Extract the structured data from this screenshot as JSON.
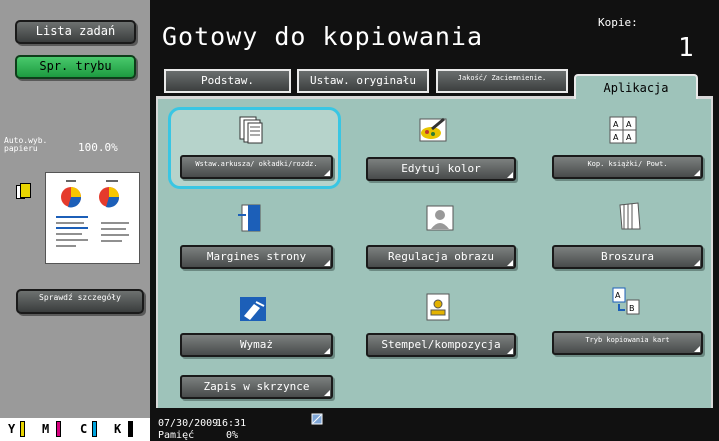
{
  "left": {
    "task_list_label": "Lista zadań",
    "check_mode_label": "Spr. trybu",
    "paper_label": "Auto.wyb. papieru",
    "zoom": "100.0%",
    "check_details_label": "Sprawdź szczegóły",
    "toner": [
      "Y",
      "M",
      "C",
      "K"
    ]
  },
  "header": {
    "title": "Gotowy do kopiowania",
    "copies_label": "Kopie:",
    "copies_value": "1"
  },
  "tabs": {
    "basic": "Podstaw.",
    "original": "Ustaw. oryginału",
    "quality": "Jakość/ Zaciemnienie.",
    "application": "Aplikacja"
  },
  "functions": {
    "sheet_cover": "Wstaw.arkusza/ okładki/rozdz.",
    "edit_color": "Edytuj kolor",
    "book_copy": "Kop. książki/ Powt.",
    "page_margin": "Margines strony",
    "image_adjust": "Regulacja obrazu",
    "booklet": "Broszura",
    "erase": "Wymaż",
    "stamp": "Stempel/kompozycja",
    "card_mode": "Tryb kopiowania kart",
    "box_save": "Zapis w skrzynce"
  },
  "status": {
    "date": "07/30/2009",
    "time": "16:31",
    "memory_label": "Pamięć",
    "memory_value": "0%"
  },
  "colors": {
    "panel": "#9ec3ba",
    "highlight": "#39c6e3",
    "green_button": "#1d9b40",
    "toner_y": "#e8d400",
    "toner_m": "#d6007f",
    "toner_c": "#00a4de",
    "toner_k": "#000000"
  },
  "icons": [
    "sheet-stack-icon",
    "brush-palette-icon",
    "book-pages-icon",
    "margin-page-icon",
    "image-adjust-icon",
    "booklet-icon",
    "erase-icon",
    "stamp-icon",
    "card-copy-icon",
    "network-icon",
    "tray-icon"
  ]
}
